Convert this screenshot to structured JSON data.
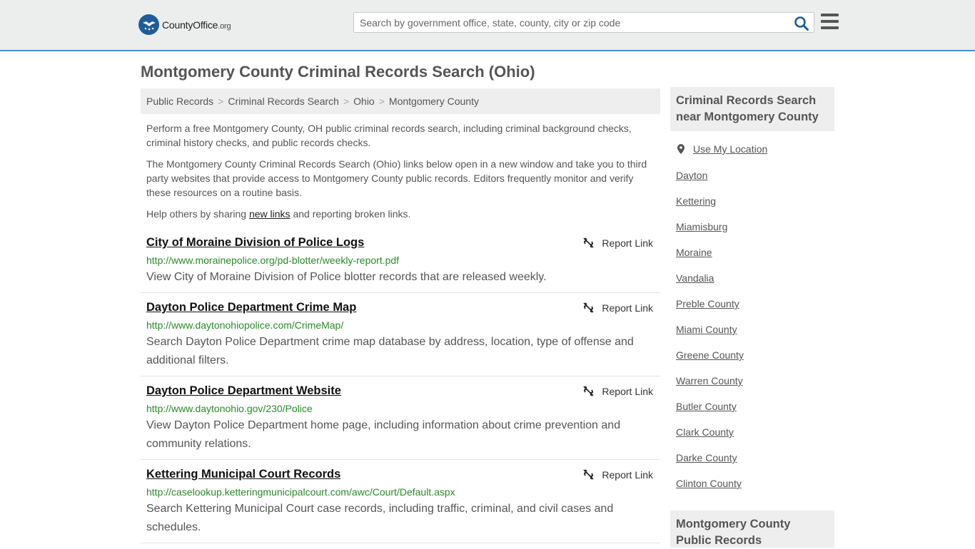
{
  "header": {
    "logo_main": "CountyOffice",
    "logo_tld": ".org",
    "search_placeholder": "Search by government office, state, county, city or zip code"
  },
  "page": {
    "title": "Montgomery County Criminal Records Search (Ohio)"
  },
  "breadcrumb": [
    "Public Records",
    "Criminal Records Search",
    "Ohio",
    "Montgomery County"
  ],
  "intro": {
    "p1": "Perform a free Montgomery County, OH public criminal records search, including criminal background checks, criminal history checks, and public records checks.",
    "p2": "The Montgomery County Criminal Records Search (Ohio) links below open in a new window and take you to third party websites that provide access to Montgomery County public records. Editors frequently monitor and verify these resources on a routine basis.",
    "p3_before": "Help others by sharing ",
    "p3_link": "new links",
    "p3_after": " and reporting broken links."
  },
  "report_label": "Report Link",
  "results": [
    {
      "title": "City of Moraine Division of Police Logs",
      "url": "http://www.morainepolice.org/pd-blotter/weekly-report.pdf",
      "desc": "View City of Moraine Division of Police blotter records that are released weekly."
    },
    {
      "title": "Dayton Police Department Crime Map",
      "url": "http://www.daytonohiopolice.com/CrimeMap/",
      "desc": "Search Dayton Police Department crime map database by address, location, type of offense and additional filters."
    },
    {
      "title": "Dayton Police Department Website",
      "url": "http://www.daytonohio.gov/230/Police",
      "desc": "View Dayton Police Department home page, including information about crime prevention and community relations."
    },
    {
      "title": "Kettering Municipal Court Records",
      "url": "http://caselookup.ketteringmunicipalcourt.com/awc/Court/Default.aspx",
      "desc": "Search Kettering Municipal Court case records, including traffic, criminal, and civil cases and schedules."
    }
  ],
  "sidebar": {
    "heading": "Criminal Records Search near Montgomery County",
    "use_location": "Use My Location",
    "links": [
      "Dayton",
      "Kettering",
      "Miamisburg",
      "Moraine",
      "Vandalia",
      "Preble County",
      "Miami County",
      "Greene County",
      "Warren County",
      "Butler County",
      "Clark County",
      "Darke County",
      "Clinton County"
    ],
    "heading2": "Montgomery County Public Records"
  },
  "colors": {
    "url_green": "#2a8a2a",
    "logo_blue": "#1f5c99",
    "accent_border": "#4a90d9"
  },
  "icons": {
    "logo": "eagle-stars-logo-icon",
    "search": "search-icon",
    "menu": "hamburger-menu-icon",
    "report": "broken-link-icon",
    "location": "map-pin-icon"
  }
}
